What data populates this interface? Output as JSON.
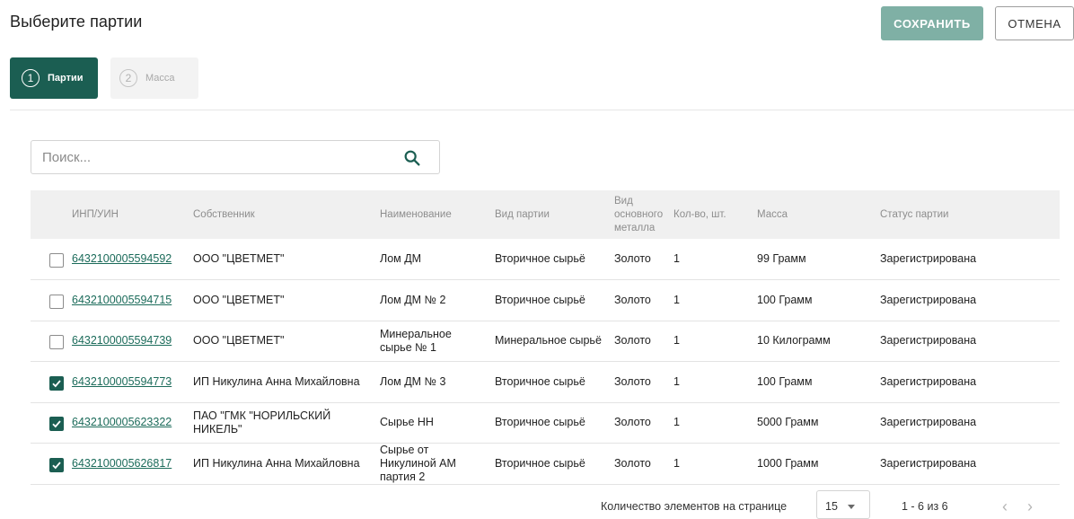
{
  "header": {
    "title": "Выберите партии",
    "save_label": "СОХРАНИТЬ",
    "cancel_label": "ОТМЕНА"
  },
  "steps": [
    {
      "number": "1",
      "label": "Партии",
      "active": true
    },
    {
      "number": "2",
      "label": "Масса",
      "active": false
    }
  ],
  "search": {
    "placeholder": "Поиск...",
    "value": "",
    "icon": "search-icon"
  },
  "table": {
    "columns": [
      "ИНП/УИН",
      "Собственник",
      "Наименование",
      "Вид партии",
      "Вид основного металла",
      "Кол-во, шт.",
      "Масса",
      "Статус партии"
    ],
    "rows": [
      {
        "checked": false,
        "id": "6432100005594592",
        "owner": "ООО \"ЦВЕТМЕТ\"",
        "name": "Лом ДМ",
        "type": "Вторичное сырьё",
        "metal": "Золото",
        "qty": "1",
        "mass": "99 Грамм",
        "status": "Зарегистрирована"
      },
      {
        "checked": false,
        "id": "6432100005594715",
        "owner": "ООО \"ЦВЕТМЕТ\"",
        "name": "Лом ДМ № 2",
        "type": "Вторичное сырьё",
        "metal": "Золото",
        "qty": "1",
        "mass": "100 Грамм",
        "status": "Зарегистрирована"
      },
      {
        "checked": false,
        "id": "6432100005594739",
        "owner": "ООО \"ЦВЕТМЕТ\"",
        "name": "Минеральное сырье № 1",
        "type": "Минеральное сырьё",
        "metal": "Золото",
        "qty": "1",
        "mass": "10 Килограмм",
        "status": "Зарегистрирована"
      },
      {
        "checked": true,
        "id": "6432100005594773",
        "owner": "ИП Никулина Анна Михайловна",
        "name": "Лом ДМ № 3",
        "type": "Вторичное сырьё",
        "metal": "Золото",
        "qty": "1",
        "mass": "100 Грамм",
        "status": "Зарегистрирована"
      },
      {
        "checked": true,
        "id": "6432100005623322",
        "owner": "ПАО \"ГМК \"НОРИЛЬСКИЙ НИКЕЛЬ\"",
        "name": "Сырье НН",
        "type": "Вторичное сырьё",
        "metal": "Золото",
        "qty": "1",
        "mass": "5000 Грамм",
        "status": "Зарегистрирована"
      },
      {
        "checked": true,
        "id": "6432100005626817",
        "owner": "ИП Никулина Анна Михайловна",
        "name": "Сырье от Никулиной АМ партия 2",
        "type": "Вторичное сырьё",
        "metal": "Золото",
        "qty": "1",
        "mass": "1000 Грамм",
        "status": "Зарегистрирована"
      }
    ]
  },
  "pagination": {
    "per_page_label": "Количество элементов на странице",
    "per_page_value": "15",
    "range": "1 - 6 из 6",
    "prev": "‹",
    "next": "›"
  },
  "colors": {
    "primary": "#1b5e52",
    "save_disabled": "#7fb0a5",
    "link": "#1b6b5a"
  }
}
